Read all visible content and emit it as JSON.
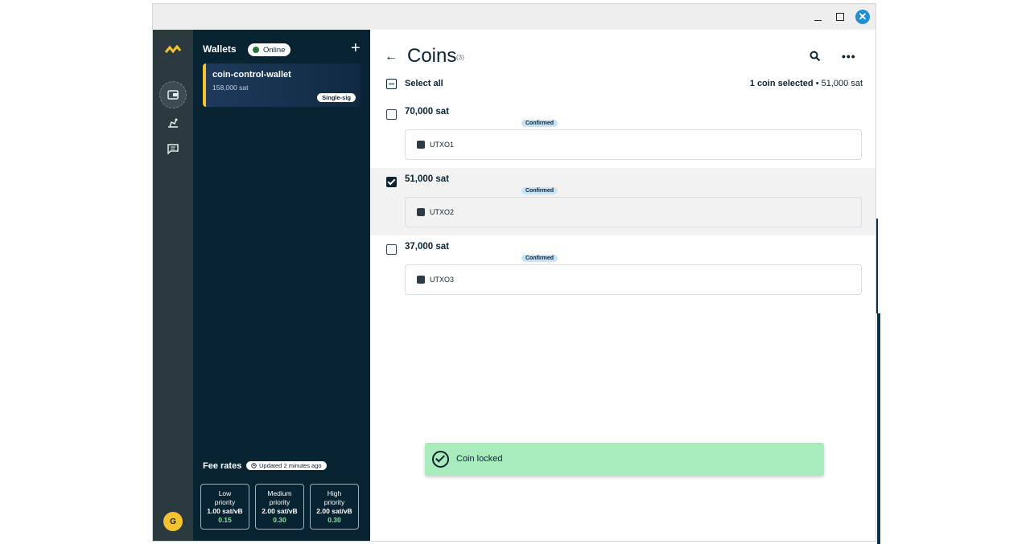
{
  "window": {
    "minimize_icon": "minimize-icon",
    "maximize_icon": "maximize-icon",
    "close_icon": "close-icon"
  },
  "wallets": {
    "header": "Wallets",
    "status": "Online",
    "add_icon": "plus-icon",
    "items": [
      {
        "name": "coin-control-wallet",
        "balance": "158,000 sat",
        "type": "Single-sig",
        "accent": "#f4c430"
      }
    ]
  },
  "fees": {
    "title": "Fee rates",
    "updated": "Updated 2 minutes ago",
    "levels": [
      {
        "line1": "Low",
        "line2": "priority",
        "rate": "1.00 sat/vB",
        "fee": "0.15"
      },
      {
        "line1": "Medium",
        "line2": "priority",
        "rate": "2.00 sat/vB",
        "fee": "0.30"
      },
      {
        "line1": "High",
        "line2": "priority",
        "rate": "2.00 sat/vB",
        "fee": "0.30"
      }
    ]
  },
  "rail": {
    "avatar_letter": "G"
  },
  "main": {
    "title": "Coins",
    "count": "(3)",
    "select_all": "Select all",
    "selected_count": "1 coin selected",
    "selected_sep": "•",
    "selected_amount": "51,000 sat",
    "coins": [
      {
        "amount": "70,000 sat",
        "status": "Confirmed",
        "label": "UTXO1",
        "checked": false
      },
      {
        "amount": "51,000 sat",
        "status": "Confirmed",
        "label": "UTXO2",
        "checked": true
      },
      {
        "amount": "37,000 sat",
        "status": "Confirmed",
        "label": "UTXO3",
        "checked": false
      }
    ]
  },
  "toast": {
    "text": "Coin locked",
    "color": "#a8ecbc"
  }
}
